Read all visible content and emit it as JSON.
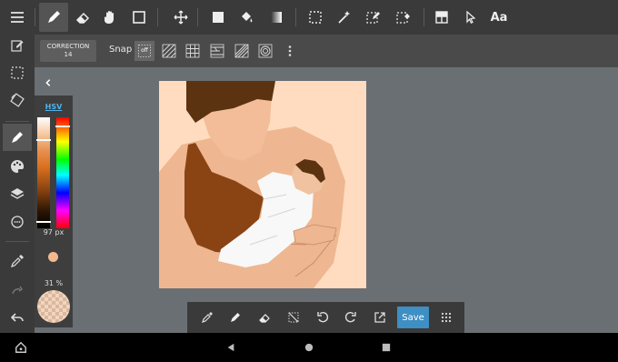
{
  "top_toolbar": {
    "tools": [
      "menu-icon",
      "pen-icon",
      "eraser-icon",
      "hand-icon",
      "square-icon",
      "move-icon",
      "fill-rect-icon",
      "bucket-icon",
      "gradient-icon",
      "select-icon",
      "magic-wand-icon",
      "select-pen-icon",
      "select-eraser-icon",
      "layout-icon",
      "pointer-icon"
    ],
    "text_tool_label": "Aa"
  },
  "sub_toolbar": {
    "correction_label": "CORRECTION",
    "correction_value": "14",
    "snap_label": "Snap",
    "snap_off_label": "off"
  },
  "color_panel": {
    "mode_label": "HSV",
    "brush_size": "97 px",
    "opacity": "31 %",
    "current_color": "#f2b98f"
  },
  "action_bar": {
    "save_label": "Save"
  },
  "colors": {
    "toolbar_bg": "#3a3a3a",
    "workspace_bg": "#6a6f73",
    "accent": "#3d8fc4",
    "canvas_bg": "#ffdcbf"
  }
}
